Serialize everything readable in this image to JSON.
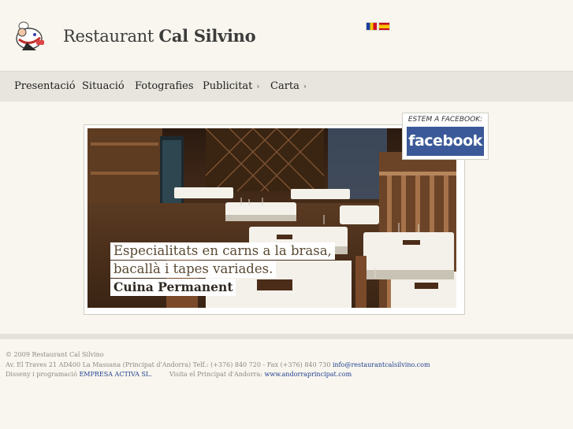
{
  "header": {
    "title_regular": "Restaurant ",
    "title_bold": "Cal Silvino",
    "flags": [
      {
        "name": "catalan-flag",
        "colors": [
          "#1a3fa0",
          "#f5c400",
          "#d01020"
        ]
      },
      {
        "name": "spanish-flag",
        "colors": [
          "#c60b1e",
          "#ffc400",
          "#c60b1e"
        ]
      }
    ]
  },
  "nav": {
    "items": [
      {
        "label": "Presentació"
      },
      {
        "label": "Situació"
      },
      {
        "label": "Fotografies"
      },
      {
        "label": "Publicitat",
        "arrow": "›"
      },
      {
        "label": "Carta",
        "arrow": "›"
      }
    ]
  },
  "hero": {
    "line1": "Especialitats en carns a la brasa,",
    "line2": "bacallà i tapes variades.",
    "line3": "Cuina Permanent"
  },
  "facebook": {
    "label": "ESTEM A FACEBOOK:",
    "logo_text": "facebook",
    "color": "#3b5998"
  },
  "footer": {
    "copyright": "© 2009 Restaurant Cal Silvino",
    "address": "Av. El Traves 21 AD400 La Massana (Principat d'Andorra) Telf.: (+376) 840 720 - Fax (+376) 840 730 ",
    "email": "info@restaurantcalsilvino.com",
    "credits_prefix": "Disseny i programació ",
    "credits_link": "EMPRESA ACTIVA SL.",
    "visit_prefix": "Visita el Principat d'Andorra: ",
    "visit_link": "www.andorraprincipat.com"
  },
  "colors": {
    "background": "#f8f6ee",
    "nav_background": "#e7e5dd",
    "link": "#1f3f8f"
  }
}
